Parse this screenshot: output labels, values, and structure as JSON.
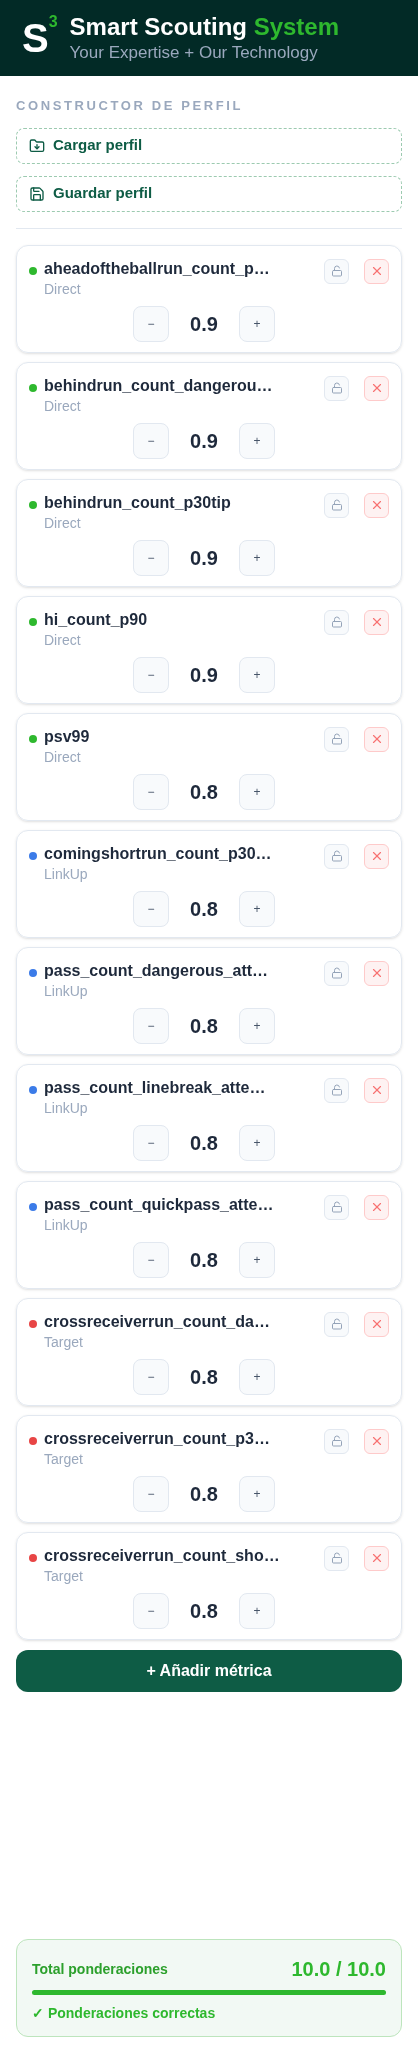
{
  "header": {
    "logo": "S",
    "logo_sup": "3",
    "title": "Smart Scouting",
    "title_accent": "System",
    "subtitle": "Your Expertise + Our Technology"
  },
  "section_title": "CONSTRUCTOR DE PERFIL",
  "actions": [
    {
      "kind": "load",
      "label": "Cargar perfil"
    },
    {
      "kind": "save",
      "label": "Guardar perfil"
    }
  ],
  "metrics": [
    {
      "name": "aheadoftheballrun_count_p…",
      "category": "Direct",
      "color": "#2eb82e",
      "weight": "0.9",
      "locked": false
    },
    {
      "name": "behindrun_count_dangerou…",
      "category": "Direct",
      "color": "#2eb82e",
      "weight": "0.9",
      "locked": false
    },
    {
      "name": "behindrun_count_p30tip",
      "category": "Direct",
      "color": "#2eb82e",
      "weight": "0.9",
      "locked": false
    },
    {
      "name": "hi_count_p90",
      "category": "Direct",
      "color": "#2eb82e",
      "weight": "0.9",
      "locked": false
    },
    {
      "name": "psv99",
      "category": "Direct",
      "color": "#2eb82e",
      "weight": "0.8",
      "locked": false
    },
    {
      "name": "comingshortrun_count_p30…",
      "category": "LinkUp",
      "color": "#3b7be8",
      "weight": "0.8",
      "locked": false
    },
    {
      "name": "pass_count_dangerous_att…",
      "category": "LinkUp",
      "color": "#3b7be8",
      "weight": "0.8",
      "locked": false
    },
    {
      "name": "pass_count_linebreak_atte…",
      "category": "LinkUp",
      "color": "#3b7be8",
      "weight": "0.8",
      "locked": false
    },
    {
      "name": "pass_count_quickpass_atte…",
      "category": "LinkUp",
      "color": "#3b7be8",
      "weight": "0.8",
      "locked": false
    },
    {
      "name": "crossreceiverrun_count_da…",
      "category": "Target",
      "color": "#e84545",
      "weight": "0.8",
      "locked": false
    },
    {
      "name": "crossreceiverrun_count_p3…",
      "category": "Target",
      "color": "#e84545",
      "weight": "0.8",
      "locked": false
    },
    {
      "name": "crossreceiverrun_count_sho…",
      "category": "Target",
      "color": "#e84545",
      "weight": "0.8",
      "locked": false
    }
  ],
  "stepper": {
    "minus": "−",
    "plus": "+"
  },
  "add_button": "+ Añadir métrica",
  "summary": {
    "label": "Total ponderaciones",
    "total": "10.0 / 10.0",
    "level": 1,
    "valid": true,
    "status": "✓ Ponderaciones correctas"
  }
}
